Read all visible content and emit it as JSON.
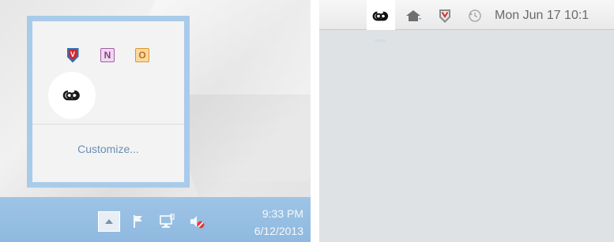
{
  "windows": {
    "tray_flyout": {
      "icons": [
        {
          "name": "mcafee-icon",
          "glyph": "V",
          "color": "#2e70b8"
        },
        {
          "name": "onenote-icon",
          "glyph": "N",
          "color": "#a55ba5"
        },
        {
          "name": "office-icon",
          "glyph": "O",
          "color": "#e0962c"
        },
        {
          "name": "creative-cloud-icon",
          "highlighted": true
        }
      ],
      "customize_label": "Customize..."
    },
    "taskbar": {
      "icons": [
        "show-hidden-icons-chevron",
        "action-center-flag-icon",
        "network-icon",
        "volume-muted-icon"
      ],
      "time": "9:33 PM",
      "date": "6/12/2013"
    },
    "accent_color": "#a9cbea"
  },
  "mac": {
    "menubar": {
      "icons": [
        {
          "name": "creative-cloud-icon",
          "highlighted": true
        },
        {
          "name": "home-sharing-icon"
        },
        {
          "name": "mcafee-icon"
        },
        {
          "name": "time-machine-icon"
        }
      ],
      "clock": "Mon Jun 17 10:1"
    }
  }
}
